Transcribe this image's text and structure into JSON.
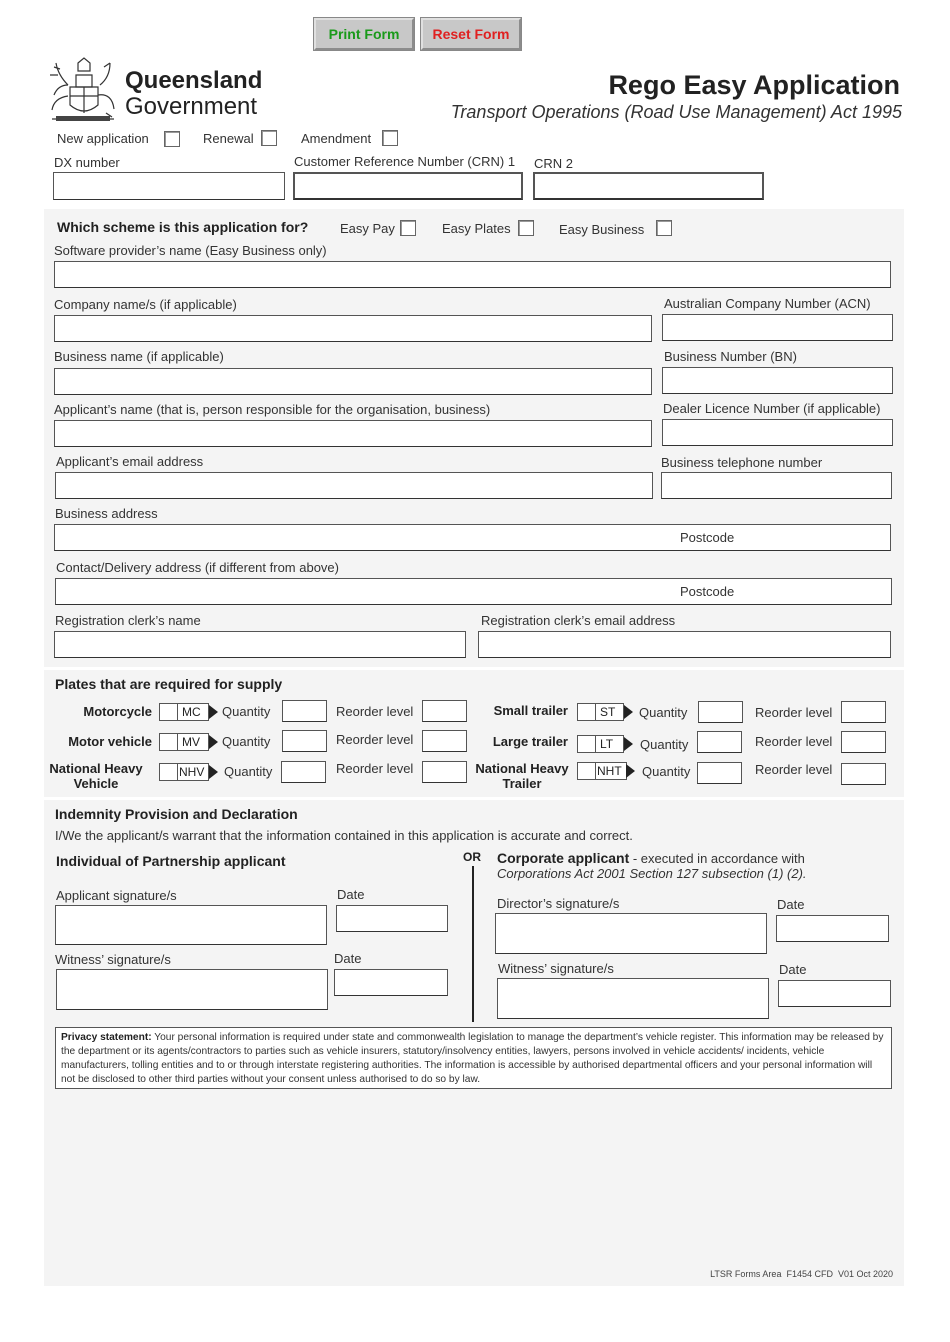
{
  "toolbar": {
    "print_label": "Print Form",
    "reset_label": "Reset Form",
    "print_color": "#1a9a1a",
    "reset_color": "#e02020"
  },
  "header": {
    "logo_line1": "Queensland",
    "logo_line2": "Government",
    "title": "Rego Easy Application",
    "subtitle": "Transport Operations (Road Use Management) Act 1995"
  },
  "application_type": {
    "options": [
      {
        "label": "New application",
        "checked": false
      },
      {
        "label": "Renewal",
        "checked": false
      },
      {
        "label": "Amendment",
        "checked": false
      }
    ]
  },
  "ids": {
    "dx_label": "DX number",
    "crn1_label": "Customer Reference Number (CRN) 1",
    "crn2_label": "CRN 2"
  },
  "scheme": {
    "question": "Which scheme is this application for?",
    "options": [
      {
        "label": "Easy Pay",
        "checked": false
      },
      {
        "label": "Easy Plates",
        "checked": false
      },
      {
        "label": "Easy Business",
        "checked": false
      }
    ]
  },
  "fields": {
    "software_provider": "Software provider’s name (Easy Business only)",
    "company_name": "Company name/s (if applicable)",
    "acn": "Australian Company Number (ACN)",
    "business_name": "Business name (if applicable)",
    "bn": "Business Number (BN)",
    "applicant_name": "Applicant’s name (that is, person responsible for the organisation, business)",
    "dealer_licence": "Dealer Licence Number (if applicable)",
    "applicant_email": "Applicant’s email address",
    "business_phone": "Business telephone number",
    "business_address": "Business address",
    "postcode1": "Postcode",
    "contact_address": "Contact/Delivery address (if different from above)",
    "postcode2": "Postcode",
    "clerk_name": "Registration clerk’s name",
    "clerk_email": "Registration clerk’s email address"
  },
  "plates": {
    "title": "Plates that are required for supply",
    "quantity_label": "Quantity",
    "reorder_label": "Reorder level",
    "left": [
      {
        "name": "Motorcycle",
        "code": "MC"
      },
      {
        "name": "Motor vehicle",
        "code": "MV"
      },
      {
        "name": "National Heavy Vehicle",
        "code": "NHV"
      }
    ],
    "right": [
      {
        "name": "Small trailer",
        "code": "ST"
      },
      {
        "name": "Large trailer",
        "code": "LT"
      },
      {
        "name": "National Heavy Trailer",
        "code": "NHT"
      }
    ]
  },
  "declaration": {
    "title": "Indemnity Provision and Declaration",
    "statement": "I/We the applicant/s warrant that the information contained in this application is accurate and correct.",
    "individual_title": "Individual of Partnership applicant",
    "or": "OR",
    "corporate_title": "Corporate applicant",
    "corporate_rest": " - executed in accordance with",
    "corporate_act": "Corporations Act 2001 Section 127 subsection (1) (2).",
    "applicant_sig": "Applicant signature/s",
    "date1": "Date",
    "witness_sig1": "Witness’ signature/s",
    "date2": "Date",
    "director_sig": "Director’s signature/s",
    "date3": "Date",
    "witness_sig2": "Witness’ signature/s",
    "date4": "Date"
  },
  "privacy": {
    "label": "Privacy statement:",
    "text": " Your personal information is required under state and commonwealth legislation to manage the department’s vehicle register. This information may be released by the department or its agents/contractors to parties such as vehicle insurers, statutory/insolvency entities, lawyers, persons involved in vehicle accidents/ incidents, vehicle manufacturers, tolling entities and to or through interstate registering authorities. The information is accessible by authorised departmental officers and your personal information will not be disclosed to other third parties without your consent unless authorised to do so by law."
  },
  "footer": {
    "text": "LTSR Forms Area  F1454 CFD  V01 Oct 2020"
  }
}
